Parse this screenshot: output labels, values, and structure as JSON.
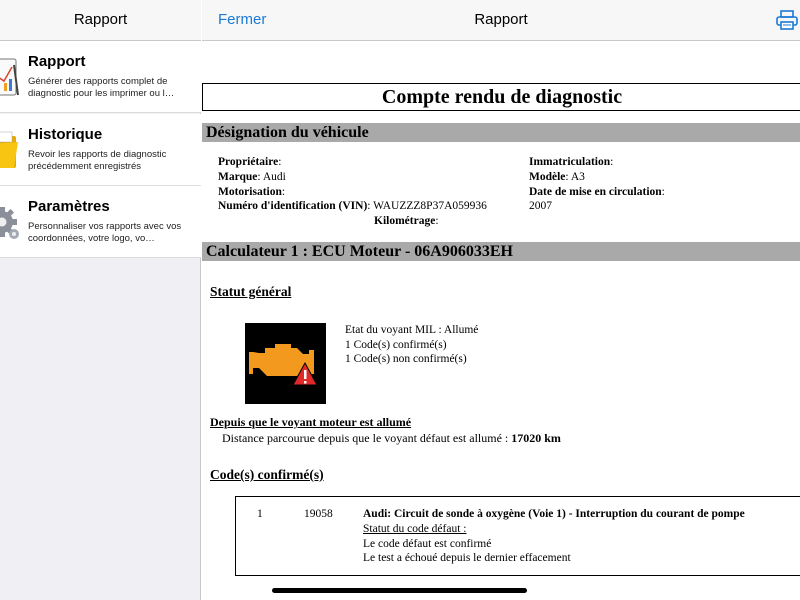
{
  "sidebar": {
    "title": "Rapport",
    "items": [
      {
        "title": "Rapport",
        "desc": "Générer des rapports complet de diagnostic pour les imprimer ou l…",
        "icon": "report-chart-icon"
      },
      {
        "title": "Historique",
        "desc": "Revoir les rapports de diagnostic précédemment enregistrés",
        "icon": "folder-icon"
      },
      {
        "title": "Paramètres",
        "desc": "Personnaliser vos rapports avec vos coordonnées, votre logo, vo…",
        "icon": "gear-icon"
      }
    ]
  },
  "nav": {
    "close": "Fermer",
    "title": "Rapport",
    "print_icon": "printer-icon"
  },
  "report": {
    "title": "Compte rendu de diagnostic",
    "vehicle_section": "Désignation du véhicule",
    "owner_label": "Propriétaire",
    "owner_value": "",
    "brand_label": "Marque",
    "brand_value": "Audi",
    "engine_label": "Motorisation",
    "engine_value": "",
    "vin_label": "Numéro d'identification (VIN)",
    "vin_value": "WAUZZZ8P37A059936",
    "mileage_label": "Kilométrage",
    "mileage_value": "",
    "plate_label": "Immatriculation",
    "plate_value": "",
    "model_label": "Modèle",
    "model_value": "A3",
    "date_label": "Date de mise en circulation",
    "date_value": "2007",
    "ecu_section": "Calculateur 1 : ECU Moteur - 06A906033EH",
    "status_heading": "Statut général",
    "mil_status": "Etat du voyant MIL : Allumé",
    "confirmed_count": "1 Code(s) confirmé(s)",
    "unconfirmed_count": "1 Code(s) non confirmé(s)",
    "since_heading": "Depuis que le voyant moteur est allumé",
    "distance_text": "Distance parcourue depuis que le voyant défaut est allumé :",
    "distance_value": "17020 km",
    "confirmed_heading": "Code(s) confirmé(s)",
    "code_index": "1",
    "code_number": "19058",
    "code_title": "Audi: Circuit de sonde à oxygène (Voie 1) - Interruption du courant de pompe",
    "code_status_heading": "Statut du code défaut :",
    "code_status_1": "Le code défaut est confirmé",
    "code_status_2": "Le test a échoué depuis le dernier effacement"
  },
  "colors": {
    "accent": "#1a7ad6",
    "band": "#a9a9a9",
    "engine_warning": "#f39a1e"
  }
}
